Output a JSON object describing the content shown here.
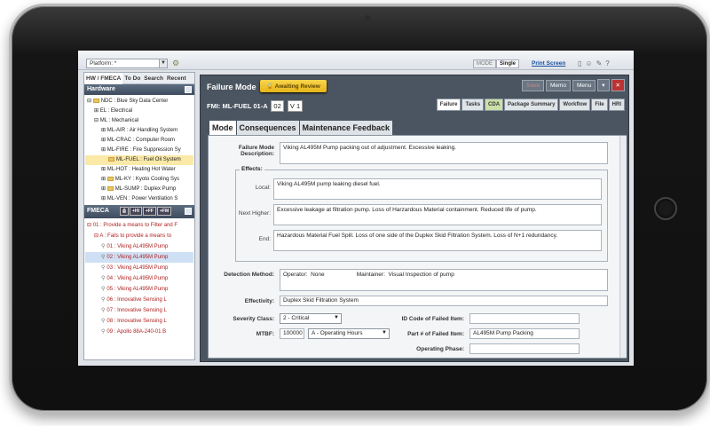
{
  "toolbar": {
    "platform_value": "Platform: *",
    "mode_label": "MODE",
    "mode_value": "Single",
    "print_label": "Print Screen"
  },
  "left": {
    "tabs": [
      "HW / FMECA",
      "To Do",
      "Search",
      "Recent"
    ],
    "hardware_title": "Hardware",
    "tree": [
      "NDC : Blue Sky Data Center",
      "EL : Electrical",
      "ML : Mechanical",
      "ML-AIR : Air Handling System",
      "ML-CRAC : Computer Room",
      "ML-FIRE : Fire Suppression Sy",
      "ML-FUEL : Fuel Oil System",
      "ML-HOT : Heating Hot Water",
      "ML-KY : Kyoto Cooling Sys",
      "ML-SUMP : Duplex Pump",
      "ML-VEN : Power Ventilation S"
    ],
    "fmeca_title": "FMECA",
    "fmeca_buttons": [
      "+HI",
      "+FF",
      "+FM"
    ],
    "fmeca_list": [
      "01 : Provide a means to Filter and F",
      "A : Fails to provide a means to",
      "01 : Viking AL495M Pump",
      "02 : Viking AL495M Pump",
      "03 : Viking AL495M Pump",
      "04 : Viking AL495M Pump",
      "05 : Viking AL495M Pump",
      "06 : Innovative Sensing L",
      "07 : Innovative Sensing L",
      "08 : Innovative Sensing L",
      "09 : Apollo 88A-240-01 B"
    ]
  },
  "main": {
    "title": "Failure Mode",
    "status_badge": "Awaiting Review",
    "header_buttons": [
      "Save",
      "Memo",
      "Menu"
    ],
    "fmi_label": "FMI: ML-FUEL 01-A",
    "fmi_num": "02",
    "fmi_version": "V 1",
    "right_tabs": [
      "Failure",
      "Tasks",
      "CDA",
      "Package Summary",
      "Workflow",
      "File",
      "HRI"
    ],
    "sub_tabs": [
      "Mode",
      "Consequences",
      "Maintenance Feedback"
    ]
  },
  "form": {
    "fm_desc_label": "Failure Mode Description:",
    "fm_desc_value": "Viking AL495M Pump packing out of adjustment.  Excessive leaking.",
    "effects_label": "Effects:",
    "local_label": "Local:",
    "local_value": "Viking AL495M pump leaking diesel fuel.",
    "next_label": "Next Higher:",
    "next_value": "Excessive leakage at filtration pump.  Loss of Harzardous Material containment.  Reduced life of pump.",
    "end_label": "End:",
    "end_value": "Hazardous Material Fuel Spill.  Loss of one side of the Duplex Skid Filtration System.  Loss of N+1 redundancy.",
    "detection_label": "Detection Method:",
    "detection_value": "Operator:  None                    Maintainer:  Visual Inspection of pump",
    "effectivity_label": "Effectivity:",
    "effectivity_value": "Duplex Skid Filtration System",
    "severity_label": "Severity Class:",
    "severity_value": "2 - Critical",
    "mtbf_label": "MTBF:",
    "mtbf_value": "100000",
    "mtbf_unit": "A - Operating Hours",
    "idcode_label": "ID Code of Failed Item:",
    "part_label": "Part # of Failed Item:",
    "part_value": "AL495M Pump Packing",
    "phase_label": "Operating Phase:"
  }
}
